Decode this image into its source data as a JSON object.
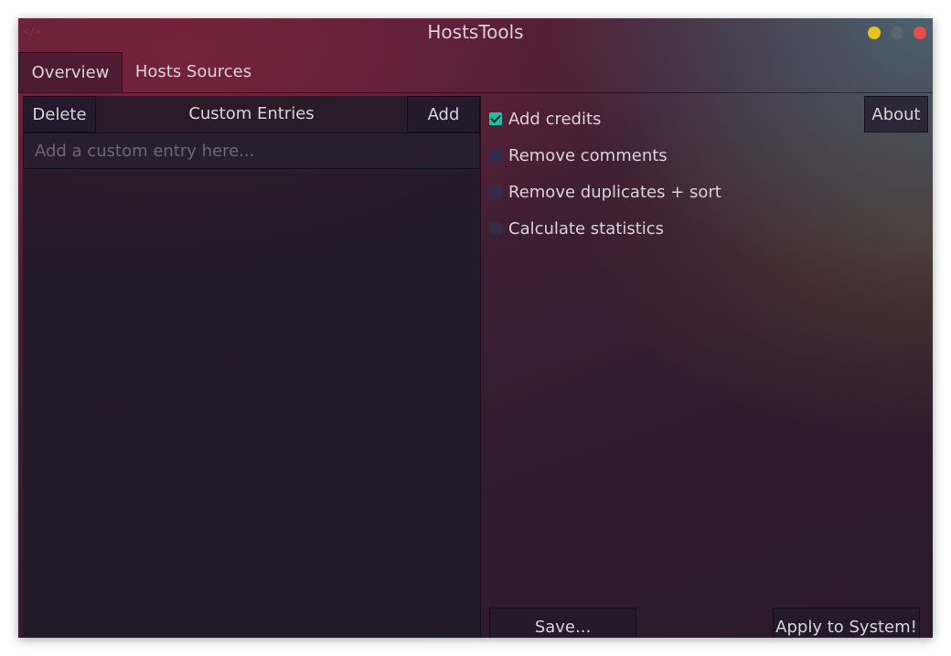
{
  "window": {
    "title": "HostsTools",
    "app_icon": "</>",
    "controls": [
      "minimize",
      "maximize",
      "close"
    ],
    "control_colors": {
      "minimize": "#e6c21c",
      "maximize": "#5d6572",
      "close": "#e74c4c"
    }
  },
  "tabs": [
    {
      "label": "Overview",
      "active": true
    },
    {
      "label": "Hosts Sources",
      "active": false
    }
  ],
  "left": {
    "delete_label": "Delete",
    "title": "Custom Entries",
    "add_label": "Add",
    "entry_placeholder": "Add a custom entry here...",
    "entries": []
  },
  "right": {
    "about_label": "About",
    "options": [
      {
        "label": "Add credits",
        "checked": true
      },
      {
        "label": "Remove comments",
        "checked": false
      },
      {
        "label": "Remove duplicates + sort",
        "checked": false
      },
      {
        "label": "Calculate statistics",
        "checked": false
      }
    ],
    "save_label": "Save...",
    "apply_label": "Apply to System!"
  },
  "colors": {
    "accent": "#17c4a6",
    "text": "#d9d3dc"
  }
}
